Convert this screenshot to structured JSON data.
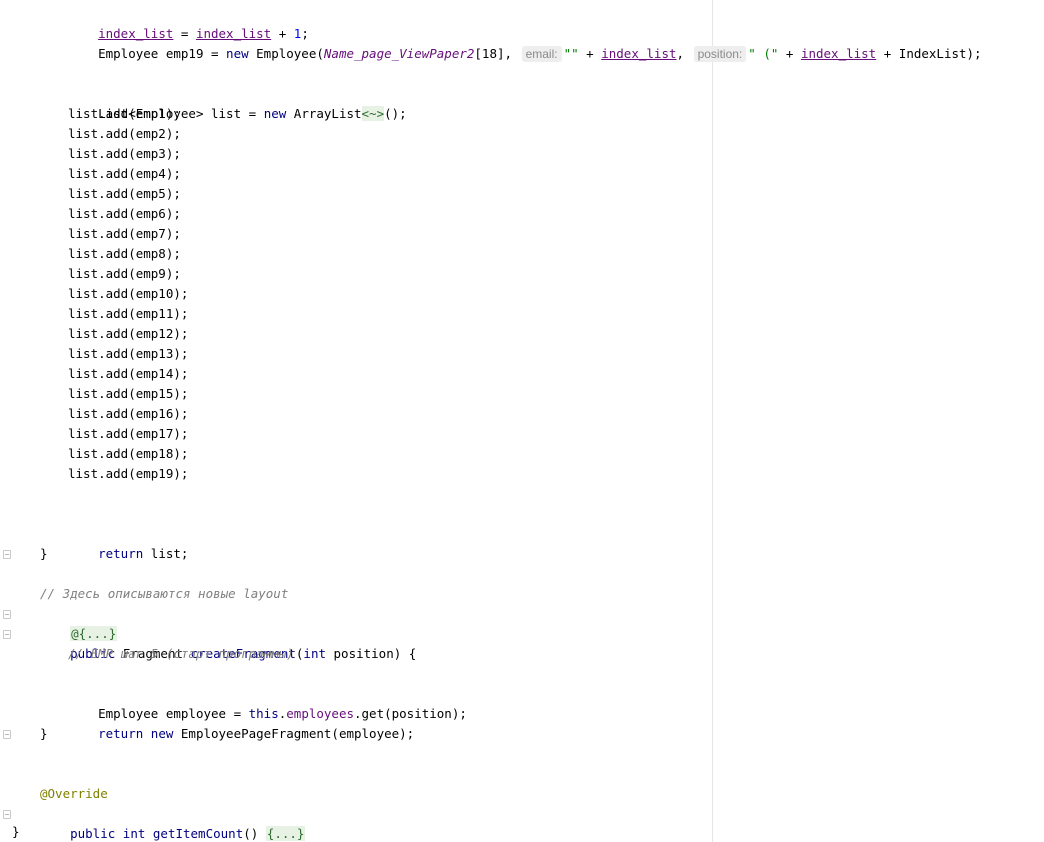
{
  "editor": {
    "lines": {
      "l0": {
        "a": "index_list",
        "b": " = ",
        "c": "index_list",
        "d": " + ",
        "e": "1",
        "f": ";"
      },
      "l1": {
        "type": "Employee emp19 = ",
        "new_kw": "new",
        "ctor": " Employee(",
        "field": "Name_page_ViewPaper2",
        "idx": "[18]",
        "comma1": ", ",
        "hint_email": "email:",
        "str1": "\"\"",
        "plus1": " + ",
        "var1": "index_list",
        "comma2": ", ",
        "hint_position": "position:",
        "str2": "\" (\"",
        "plus2": " + ",
        "var2": "index_list",
        "tail": " + IndexList);"
      },
      "list_decl": {
        "a": "List<Employee> list = ",
        "new_kw": "new",
        "b": " ArrayList",
        "diamond": "<~>",
        "c": "();"
      },
      "adds": [
        "list.add(emp1);",
        "list.add(emp2);",
        "list.add(emp3);",
        "list.add(emp4);",
        "list.add(emp5);",
        "list.add(emp6);",
        "list.add(emp7);",
        "list.add(emp8);",
        "list.add(emp9);",
        "list.add(emp10);",
        "list.add(emp11);",
        "list.add(emp12);",
        "list.add(emp13);",
        "list.add(emp14);",
        "list.add(emp15);",
        "list.add(emp16);",
        "list.add(emp17);",
        "list.add(emp18);",
        "list.add(emp19);"
      ],
      "return_list": {
        "kw": "return",
        "rest": " list;"
      },
      "close_brace1": "}",
      "comment1": "// Здесь описываются новые layout",
      "folded_anno": "@{...}",
      "create_fragment": {
        "kw": "public",
        "a": " Fragment ",
        "method": "createFragment",
        "b": "(",
        "kw2": "int",
        "c": " position) {"
      },
      "comment2": "// EMP шаг 5 (старт программы)",
      "employee_line": {
        "a": "Employee employee = ",
        "kw": "this",
        "dot": ".",
        "field": "employees",
        "b": ".get(position);"
      },
      "return_new": {
        "kw": "return",
        "sp": " ",
        "kw2": "new",
        "rest": " EmployeePageFragment(employee);"
      },
      "close_brace2": "}",
      "override": "@Override",
      "item_count": {
        "kw": "public",
        "sp": " ",
        "kw2": "int",
        "sp2": " ",
        "method": "getItemCount",
        "b": "() ",
        "folded": "{...}"
      },
      "class_close": "}"
    }
  }
}
